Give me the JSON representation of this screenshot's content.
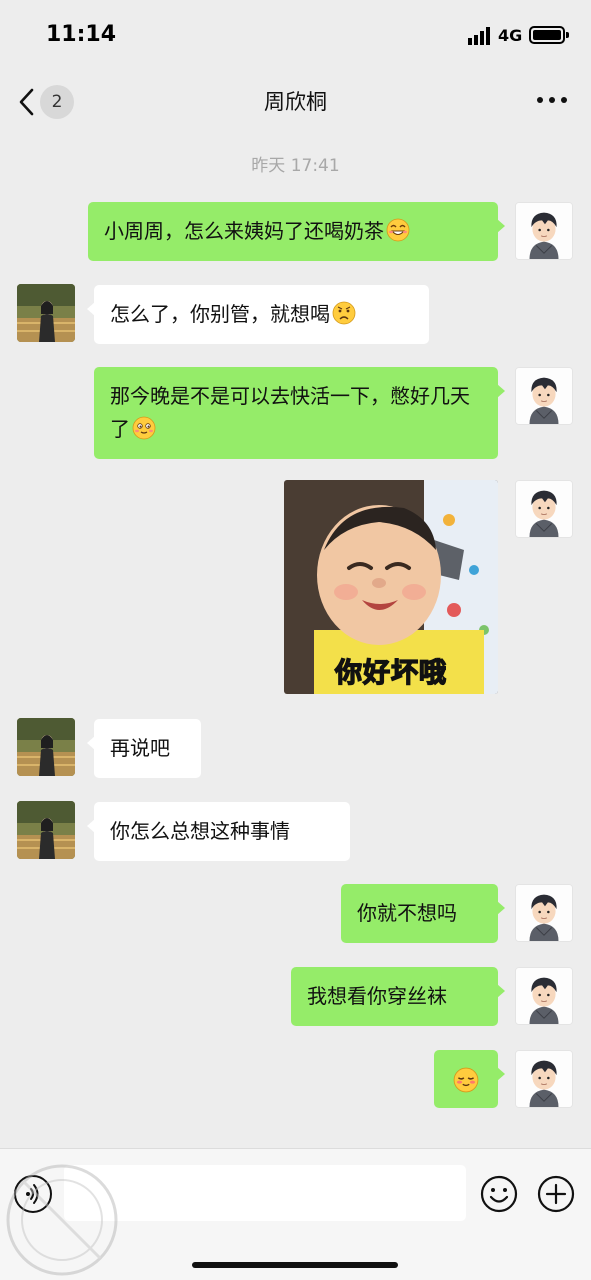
{
  "status_bar": {
    "time": "11:14",
    "network": "4G"
  },
  "nav": {
    "back_icon": "chevron-left-icon",
    "unread_count": "2",
    "title": "周欣桐",
    "more_icon": "ellipsis-icon"
  },
  "chat": {
    "time_label": "昨天 17:41",
    "messages": [
      {
        "from": "me",
        "text": "小周周，怎么来姨妈了还喝奶茶",
        "emoji": "grin-emoji"
      },
      {
        "from": "them",
        "text": "怎么了，你别管，就想喝",
        "emoji": "sad-emoji"
      },
      {
        "from": "me",
        "text": "那今晚是不是可以去快活一下，憋好几天了",
        "emoji": "shy-emoji"
      },
      {
        "from": "me",
        "type": "sticker",
        "caption": "你好坏哦"
      },
      {
        "from": "them",
        "text": "再说吧"
      },
      {
        "from": "them",
        "text": "你怎么总想这种事情"
      },
      {
        "from": "me",
        "text": "你就不想吗"
      },
      {
        "from": "me",
        "text": "我想看你穿丝袜"
      },
      {
        "from": "me",
        "text": "",
        "emoji": "blush-emoji"
      }
    ]
  },
  "input_bar": {
    "voice_icon": "voice-icon",
    "input_value": "",
    "emoji_icon": "smiley-icon",
    "plus_icon": "plus-icon"
  },
  "colors": {
    "background": "#ededed",
    "my_bubble": "#95ec69",
    "their_bubble": "#ffffff",
    "time_label": "#a8a8a8"
  }
}
